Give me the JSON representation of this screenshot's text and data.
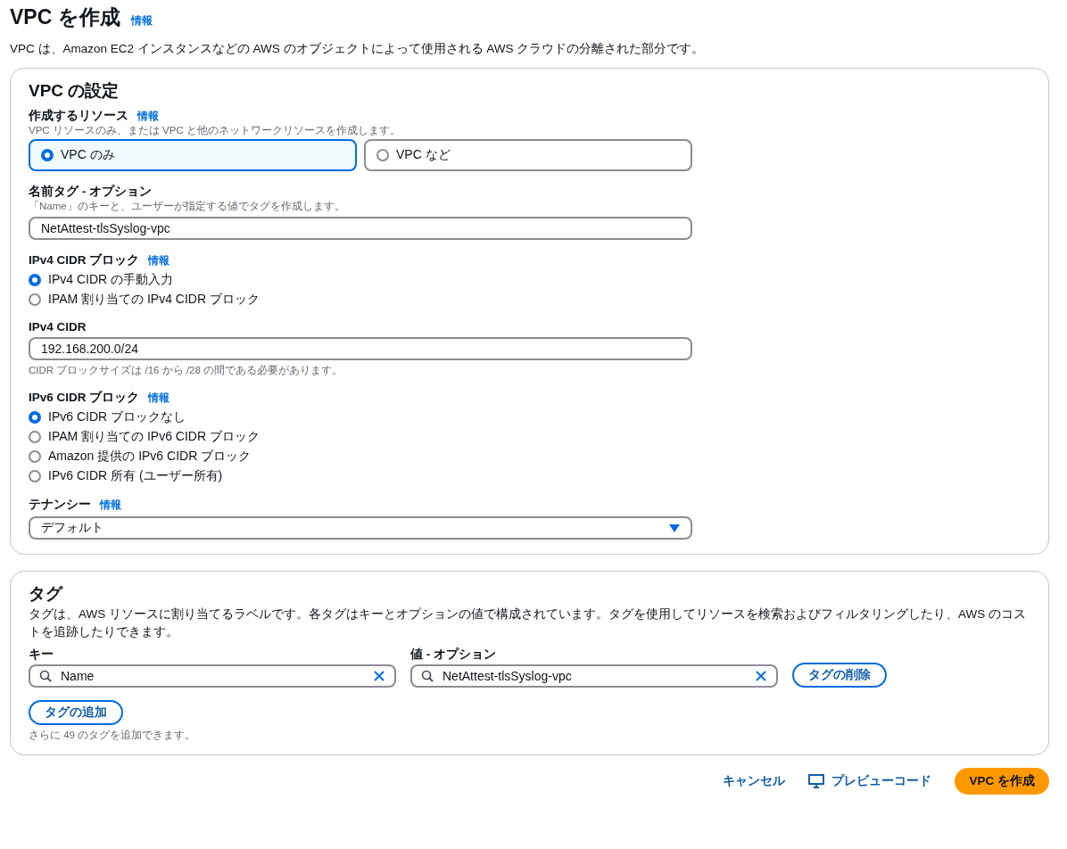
{
  "page": {
    "title": "VPC を作成",
    "info": "情報",
    "description": "VPC は、Amazon EC2 インスタンスなどの AWS のオブジェクトによって使用される AWS クラウドの分離された部分です。"
  },
  "vpc_settings": {
    "heading": "VPC の設定",
    "resources": {
      "label": "作成するリソース",
      "info": "情報",
      "hint": "VPC リソースのみ、または VPC と他のネットワークリソースを作成します。",
      "options": [
        {
          "label": "VPC のみ",
          "selected": true
        },
        {
          "label": "VPC など",
          "selected": false
        }
      ]
    },
    "name_tag": {
      "label": "名前タグ - オプション",
      "hint": "「Name」のキーと、ユーザーが指定する値でタグを作成します。",
      "value": "NetAttest-tlsSyslog-vpc"
    },
    "ipv4_block": {
      "label": "IPv4 CIDR ブロック",
      "info": "情報",
      "options": [
        {
          "label": "IPv4 CIDR の手動入力",
          "selected": true
        },
        {
          "label": "IPAM 割り当ての IPv4 CIDR ブロック",
          "selected": false
        }
      ]
    },
    "ipv4_cidr": {
      "label": "IPv4 CIDR",
      "value": "192.168.200.0/24",
      "hint": "CIDR ブロックサイズは /16 から /28 の間である必要があります。"
    },
    "ipv6_block": {
      "label": "IPv6 CIDR ブロック",
      "info": "情報",
      "options": [
        {
          "label": "IPv6 CIDR ブロックなし",
          "selected": true
        },
        {
          "label": "IPAM 割り当ての IPv6 CIDR ブロック",
          "selected": false
        },
        {
          "label": "Amazon 提供の IPv6 CIDR ブロック",
          "selected": false
        },
        {
          "label": "IPv6 CIDR 所有 (ユーザー所有)",
          "selected": false
        }
      ]
    },
    "tenancy": {
      "label": "テナンシー",
      "info": "情報",
      "value": "デフォルト"
    }
  },
  "tags": {
    "heading": "タグ",
    "description": "タグは、AWS リソースに割り当てるラベルです。各タグはキーとオプションの値で構成されています。タグを使用してリソースを検索およびフィルタリングしたり、AWS のコストを追跡したりできます。",
    "key_label": "キー",
    "value_label": "値 - オプション",
    "rows": [
      {
        "key": "Name",
        "value": "NetAttest-tlsSyslog-vpc",
        "remove": "タグの削除"
      }
    ],
    "add": "タグの追加",
    "hint": "さらに 49 のタグを追加できます。"
  },
  "footer": {
    "cancel": "キャンセル",
    "preview": "プレビューコード",
    "create": "VPC を作成"
  }
}
